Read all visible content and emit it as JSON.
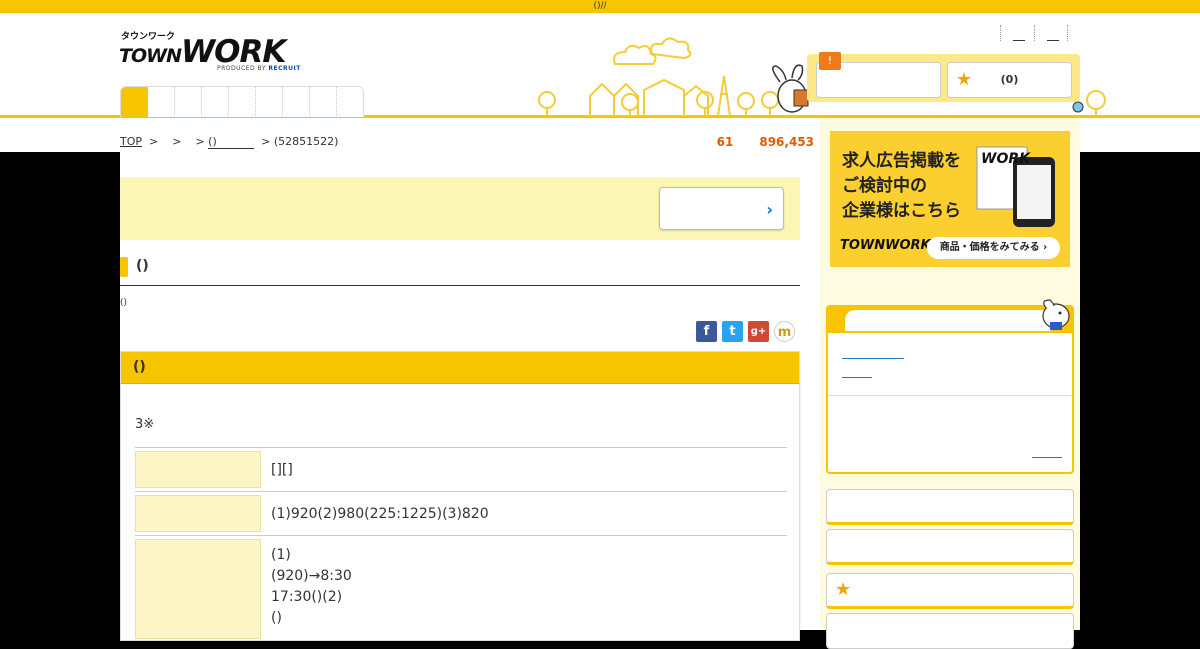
{
  "topbar": {
    "text": "()//"
  },
  "logo": {
    "kana": "タウンワーク",
    "main_big": "TOWN",
    "main_work": "WORK",
    "sub_prefix": "PRODUCED BY",
    "sub_brand": "RECRUIT"
  },
  "header": {
    "badge": "!",
    "favorites_count": "(0)"
  },
  "breadcrumb": {
    "top": "TOP",
    "sep1": ">",
    "sep2": ">",
    "sep3": ">",
    "item": "()",
    "sep4": ">",
    "job_id": "(52851522)"
  },
  "stats": {
    "count_a": "61",
    "count_b": "896,453"
  },
  "page": {
    "title": "()",
    "subtitle": "()"
  },
  "detail": {
    "heading": "()",
    "note": "3※",
    "rows": [
      {
        "value_lines": [
          "[][]"
        ]
      },
      {
        "value_lines": [
          "(1)920(2)980(225:1225)(3)820"
        ]
      },
      {
        "value_lines": [
          "(1)",
          "(920)→8:30",
          "17:30()(2)",
          "()"
        ]
      }
    ]
  },
  "ad": {
    "lines": [
      "求人広告掲載を",
      "ご検討中の",
      "企業様はこちら"
    ],
    "logo": "TOWNWORK",
    "button": "商品・価格をみてみる ›",
    "phone_brand": "WORK"
  },
  "share_icons": [
    "facebook-icon",
    "twitter-icon",
    "googleplus-icon",
    "mixi-icon"
  ],
  "colors": {
    "brand_yellow": "#f7c400",
    "accent_orange": "#e05a00",
    "link_blue": "#1a73c8",
    "promo_bg": "#fcf6b6"
  }
}
